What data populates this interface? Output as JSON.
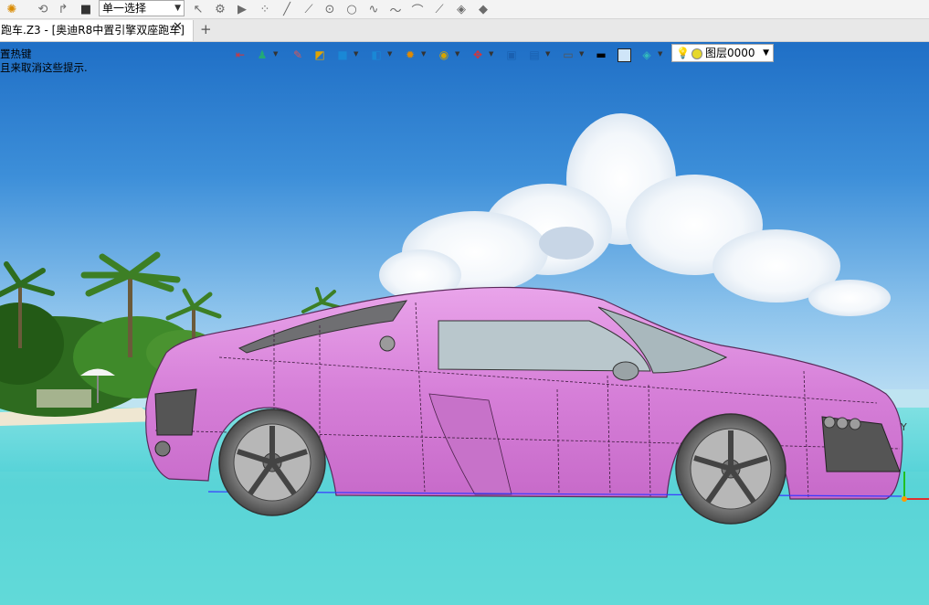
{
  "toolbar": {
    "select_mode": "单一选择",
    "icons": [
      "app-logo-icon",
      "undo-history-icon",
      "redo-history-icon",
      "stop-icon",
      "pick-arrow-icon",
      "pick-filter-icon",
      "play-icon",
      "point-icon",
      "line-icon",
      "segment-icon",
      "circle-icon",
      "circle2-icon",
      "spline-icon",
      "curve-icon",
      "arc-icon",
      "line2-icon",
      "surface-icon",
      "mesh-icon"
    ]
  },
  "tab": {
    "title": "跑车.Z3 - [奥迪R8中置引擎双座跑车]",
    "close": "✕",
    "new": "+"
  },
  "hints": {
    "line1": "置热键",
    "line2": "且来取消这些提示."
  },
  "view_toolbar": {
    "layer": "图层0000"
  },
  "colors": {
    "car_body": "#d57fd8",
    "sky_top": "#1f72c9",
    "sea": "#5cd6d8"
  }
}
